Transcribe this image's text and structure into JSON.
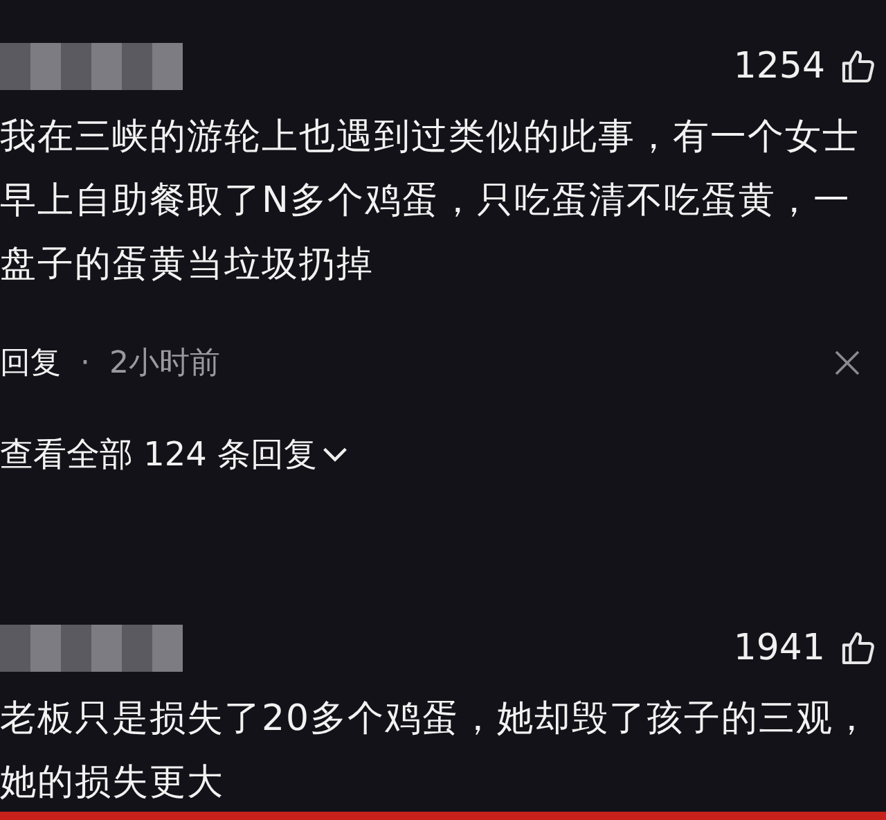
{
  "comments": [
    {
      "likes": "1254",
      "text": "我在三峡的游轮上也遇到过类似的此事，有一个女士早上自助餐取了N多个鸡蛋，只吃蛋清不吃蛋黄，一盘子的蛋黄当垃圾扔掉",
      "reply_label": "回复",
      "separator": "·",
      "time": "2小时前",
      "view_replies": "查看全部 124 条回复"
    },
    {
      "likes": "1941",
      "text": "老板只是损失了20多个鸡蛋，她却毁了孩子的三观，她的损失更大"
    }
  ]
}
